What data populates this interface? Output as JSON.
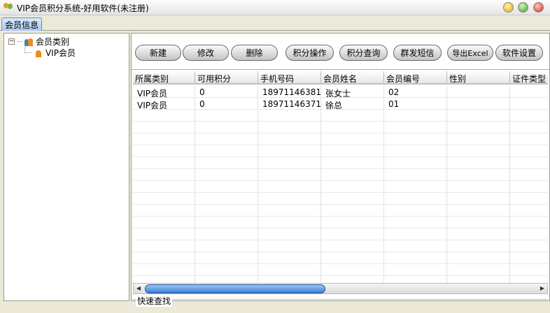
{
  "window": {
    "title": "VIP会员积分系统-好用软件(未注册)"
  },
  "tabs": [
    {
      "label": "会员信息",
      "active": true
    }
  ],
  "tree": {
    "root": "会员类别",
    "children": [
      "VIP会员"
    ]
  },
  "toolbar": {
    "buttons": [
      "新建",
      "修改",
      "删除",
      "积分操作",
      "积分查询",
      "群发短信",
      "导出Excel",
      "软件设置"
    ]
  },
  "grid": {
    "columns": [
      "所属类别",
      "可用积分",
      "手机号码",
      "会员姓名",
      "会员编号",
      "性别",
      "证件类型"
    ],
    "rows": [
      [
        "VIP会员",
        "0",
        "18971146381",
        "张女士",
        "02",
        "",
        ""
      ],
      [
        "VIP会员",
        "0",
        "18971146371",
        "徐总",
        "01",
        "",
        ""
      ]
    ]
  },
  "search_group": {
    "label": "快速查找"
  }
}
